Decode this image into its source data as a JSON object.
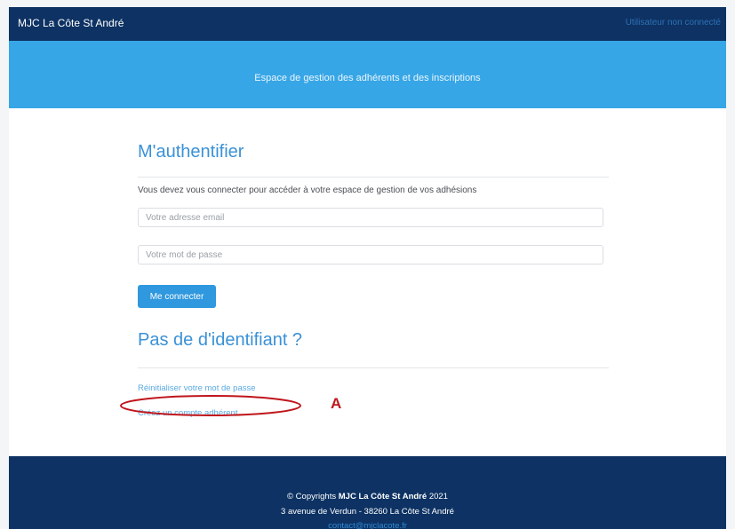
{
  "navbar": {
    "brand": "MJC La Côte St André",
    "right_link": "Utilisateur non connecté"
  },
  "hero": {
    "subtitle": "Espace de gestion des adhérents et des inscriptions"
  },
  "login": {
    "title": "M'authentifier",
    "intro": "Vous devez vous connecter pour accéder à votre espace de gestion de vos adhésions",
    "email_placeholder": "Votre adresse email",
    "password_placeholder": "Votre mot de passe",
    "submit_label": "Me connecter"
  },
  "no_account": {
    "title": "Pas de d'identifiant ?",
    "reset_link": "Réinitialiser votre mot de passe",
    "create_link": "Créez un compte adhérent"
  },
  "annotation": {
    "letter": "A",
    "color": "#c0161c"
  },
  "footer": {
    "copyright_prefix": "© Copyrights",
    "org_name": "MJC La Côte St André",
    "year": "2021",
    "address": "3 avenue de Verdun - 38260 La Côte St André",
    "email": "contact@mjclacote.fr"
  },
  "colors": {
    "navbar_bg": "#0d3263",
    "hero_bg": "#37a6e6",
    "accent": "#3a91d6",
    "button_bg": "#2f98de"
  }
}
